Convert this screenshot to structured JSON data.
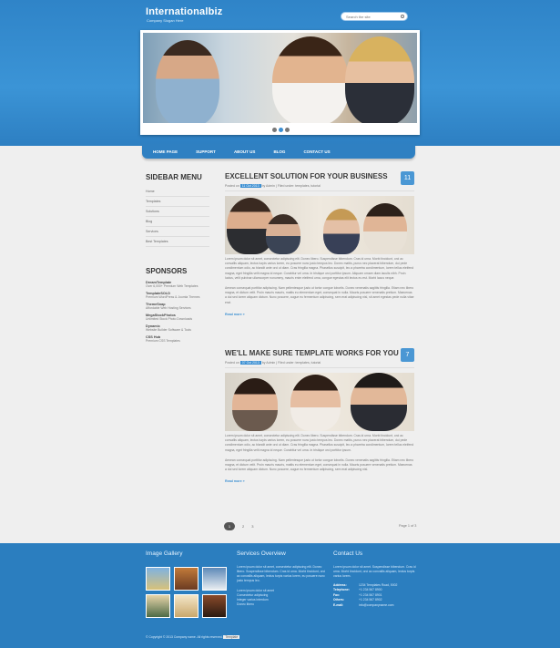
{
  "header": {
    "brand": "Internationalbiz",
    "slogan": "Company Slogan Here",
    "search_placeholder": "Search the site",
    "accent": "#3b8fd2"
  },
  "nav": {
    "items": [
      "HOME PAGE",
      "SUPPORT",
      "ABOUT US",
      "BLOG",
      "CONTACT US"
    ]
  },
  "sidebar": {
    "menu_title": "SIDEBAR MENU",
    "menu": [
      "Home",
      "Templates",
      "Solutions",
      "Blog",
      "Services",
      "Best Templates"
    ],
    "sponsors_title": "SPONSORS",
    "sponsors": [
      {
        "name": "DreamTemplate",
        "desc": "Over 6,000+ Premium Web Templates"
      },
      {
        "name": "TemplateSOLD",
        "desc": "Premium WordPress & Joomla Themes"
      },
      {
        "name": "ThemeSnap",
        "desc": "Affordable Web Hosting Services"
      },
      {
        "name": "MegaStockPhotos",
        "desc": "Unlimited Stock Photo Downloads"
      },
      {
        "name": "Dynamic",
        "desc": "Website Builder Software & Tools"
      },
      {
        "name": "CSS Hub",
        "desc": "Premium CSS Templates"
      }
    ]
  },
  "posts": [
    {
      "title": "EXCELLENT SOLUTION FOR YOUR BUSINESS",
      "day": "11",
      "meta_posted": "Posted on",
      "date": "11 Oct 2013",
      "meta_by": "by Admin",
      "meta_filed": "Filed under: templates, tutorial",
      "p1": "Lorem ipsum dolor sit amet, consectetur adipiscing elit. Donec libero. Suspendisse bibendum. Cras id urna. Morbi tincidunt, orci ac convallis aliquam, lectus turpis varius lorem, eu posuere nunc justo tempus leo. Donec mattis, purus nec placerat bibendum, dui pede condimentum odio, ac blandit ante orci ut diam. Cras fringilla magna. Phasellus suscipit, leo a pharetra condimentum, lorem tellus eleifend magna, eget fringilla velit magna id neque. Curabitur vel urna. In tristique orci porttitor ipsum. Aliquam ornare diam iaculis nibh. Proin luctus, velit pulvinar ullamcorper nonummy, mauris enim eleifend urna, congue egestas elit lectus eu est. Morbi lacus neque.",
      "p2": "Aenean consequat porttitor adipiscing. Nam pellentesque justo ut tortor congue lobortis. Donec venenatis sagittis fringilla. Etiam nec libero magna, et dictum velit. Proin mauris mauris, mattis eu elementum eget, consequat in nulla. Mauris posuere venenatis pretium. Maecenas a dui sed lorem aliquam dictum. Nunc posuere, augue eu fermentum adipiscing, sem erat adipiscing nisl, sit amet egestas pede nulla vitae erat.",
      "more": "Read more »"
    },
    {
      "title": "WE'LL MAKE SURE TEMPLATE WORKS FOR YOU",
      "day": "7",
      "meta_posted": "Posted on",
      "date": "07 Oct 2013",
      "meta_by": "by Admin",
      "meta_filed": "Filed under: templates, tutorial",
      "p1": "Lorem ipsum dolor sit amet, consectetur adipiscing elit. Donec libero. Suspendisse bibendum. Cras id urna. Morbi tincidunt, orci ac convallis aliquam, lectus turpis varius lorem, eu posuere nunc justo tempus leo. Donec mattis, purus nec placerat bibendum, dui pede condimentum odio, ac blandit ante orci ut diam. Cras fringilla magna. Phasellus suscipit, leo a pharetra condimentum, lorem tellus eleifend magna, eget fringilla velit magna id neque. Curabitur vel urna. In tristique orci porttitor ipsum.",
      "p2": "Aenean consequat porttitor adipiscing. Nam pellentesque justo ut tortor congue lobortis. Donec venenatis sagittis fringilla. Etiam nec libero magna, et dictum velit. Proin mauris mauris, mattis eu elementum eget, consequat in nulla. Mauris posuere venenatis pretium. Maecenas a dui sed lorem aliquam dictum. Nunc posuere, augue eu fermentum adipiscing, sem erat adipiscing nisl.",
      "more": "Read more »"
    }
  ],
  "pagination": {
    "current": "1",
    "pages": [
      "2",
      "3"
    ],
    "info": "Page 1 of 3"
  },
  "footer": {
    "gallery_title": "Image Gallery",
    "services_title": "Services Overview",
    "contact_title": "Contact Us",
    "services_text": "Lorem ipsum dolor sit amet, consectetur adipiscing elit. Donec libero. Suspendisse bibendum. Cras id urna. Morbi tincidunt, orci ac convallis aliquam, lectus turpis varius lorem, eu posuere nunc justo tempus leo.",
    "services_list": [
      "Lorem ipsum dolor sit amet",
      "Consectetur adipiscing",
      "Integer varius interdum",
      "Donec libero"
    ],
    "contact_text": "Lorem ipsum dolor sit amet. Suspendisse bibendum. Cras id urna. Morbi tincidunt, orci ac convallis aliquam, lectus turpis varius lorem.",
    "contact": [
      {
        "k": "Address:",
        "v": "1234 Templates Road, 5002"
      },
      {
        "k": "Telephone:",
        "v": "+1 234 567 8900"
      },
      {
        "k": "Fax:",
        "v": "+1 234 567 8901"
      },
      {
        "k": "Others:",
        "v": "+1 234 567 8902"
      },
      {
        "k": "E-mail:",
        "v": "info@companyname.com"
      }
    ],
    "copyright": "© Copyright © 2013 Company name. All rights reserved.",
    "copyright_badge": "Template"
  }
}
